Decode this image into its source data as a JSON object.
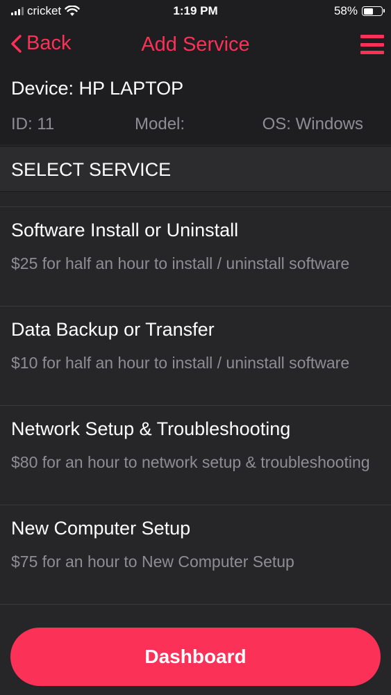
{
  "status_bar": {
    "carrier": "cricket",
    "time": "1:19 PM",
    "battery_percent": "58%",
    "battery_level": 0.58
  },
  "nav": {
    "back_label": "Back",
    "title": "Add Service"
  },
  "device": {
    "title": "Device: HP LAPTOP",
    "id": "ID: 11",
    "model": "Model:",
    "os": "OS: Windows"
  },
  "section": {
    "title": "SELECT SERVICE"
  },
  "services": [
    {
      "name": "Software Install or Uninstall",
      "description": "$25 for half an hour to install / uninstall software"
    },
    {
      "name": "Data Backup or Transfer",
      "description": "$10 for half an hour to install / uninstall software"
    },
    {
      "name": "Network Setup & Troubleshooting",
      "description": "$80 for an hour to network setup & troubleshooting"
    },
    {
      "name": "New Computer Setup",
      "description": "$75 for an hour to New Computer Setup"
    }
  ],
  "footer": {
    "dashboard_label": "Dashboard"
  },
  "colors": {
    "accent": "#fc3158",
    "background": "#262628",
    "header_background": "#1e1e20",
    "secondary_text": "#8e8e93"
  },
  "icons": {
    "back": "chevron-left-icon",
    "menu": "hamburger-menu-icon",
    "wifi": "wifi-icon",
    "signal": "signal-bars-icon",
    "battery": "battery-icon"
  }
}
